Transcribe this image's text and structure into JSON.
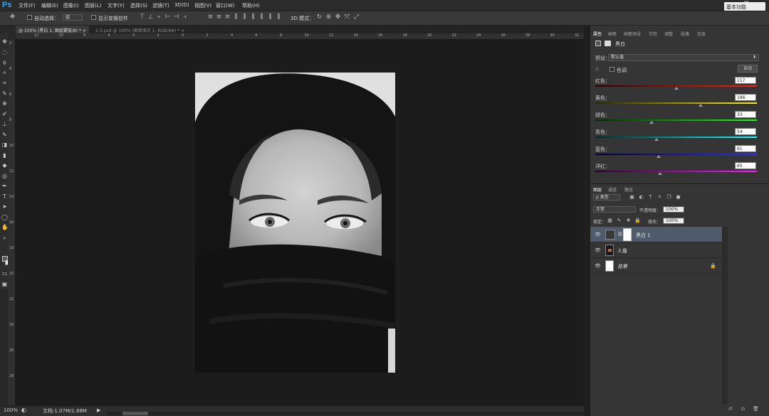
{
  "app": {
    "logo": "Ps"
  },
  "menu": [
    "文件(F)",
    "编辑(E)",
    "图像(I)",
    "图层(L)",
    "文字(Y)",
    "选择(S)",
    "滤镜(T)",
    "3D(D)",
    "视图(V)",
    "窗口(W)",
    "帮助(H)"
  ],
  "window_buttons": [
    "—",
    "❐",
    "✕"
  ],
  "options": {
    "auto_select_label": "自动选择：",
    "auto_select_value": "组",
    "show_transform_label": "显示变换控件",
    "mode_3d_label": "3D 模式：",
    "workspace": "基本功能"
  },
  "tabs": [
    {
      "label": "@ 100% (黑白 1, 图层蒙版/8) *",
      "close": "×"
    },
    {
      "label": "2-3.psd @ 100% (图案填充 1, RGB/8#) *",
      "close": "×"
    }
  ],
  "ruler": {
    "h_ticks": [
      "12",
      "10",
      "8",
      "6",
      "4",
      "2",
      "0",
      "2",
      "4",
      "6",
      "8",
      "10",
      "12",
      "14",
      "16",
      "18",
      "20",
      "22",
      "24",
      "26",
      "28",
      "30",
      "32"
    ],
    "v_ticks": [
      "2",
      "4",
      "6",
      "8",
      "10",
      "12",
      "14",
      "16",
      "18",
      "20",
      "22",
      "24",
      "26",
      "28"
    ]
  },
  "status": {
    "zoom": "100%",
    "doc": "文档:1.07M/1.88M"
  },
  "panel": {
    "tabs": [
      "属性",
      "画笔",
      "画笔预设",
      "字符",
      "调整",
      "段落",
      "信息"
    ],
    "adjustment_title": "黑白",
    "preset_label": "预设：",
    "preset_value": "默认值",
    "tint_label": "色调",
    "auto_button": "自动",
    "sliders": [
      {
        "label": "红色：",
        "value": "117",
        "pos": 0.5
      },
      {
        "label": "黄色：",
        "value": "186",
        "pos": 0.65
      },
      {
        "label": "绿色：",
        "value": "33",
        "pos": 0.35
      },
      {
        "label": "青色：",
        "value": "54",
        "pos": 0.38
      },
      {
        "label": "蓝色：",
        "value": "61",
        "pos": 0.39
      },
      {
        "label": "洋红：",
        "value": "65",
        "pos": 0.4
      }
    ]
  },
  "layers_panel": {
    "tabs": [
      "图层",
      "通道",
      "路径"
    ],
    "kind_label": "ρ 类型",
    "blend_mode": "正常",
    "opacity_label": "不透明度：",
    "opacity_value": "100%",
    "lock_label": "锁定：",
    "fill_label": "填充：",
    "fill_value": "100%",
    "layers": [
      {
        "name": "黑白 1",
        "selected": true
      },
      {
        "name": "人像",
        "selected": false
      },
      {
        "name": "背景",
        "selected": false
      }
    ]
  }
}
